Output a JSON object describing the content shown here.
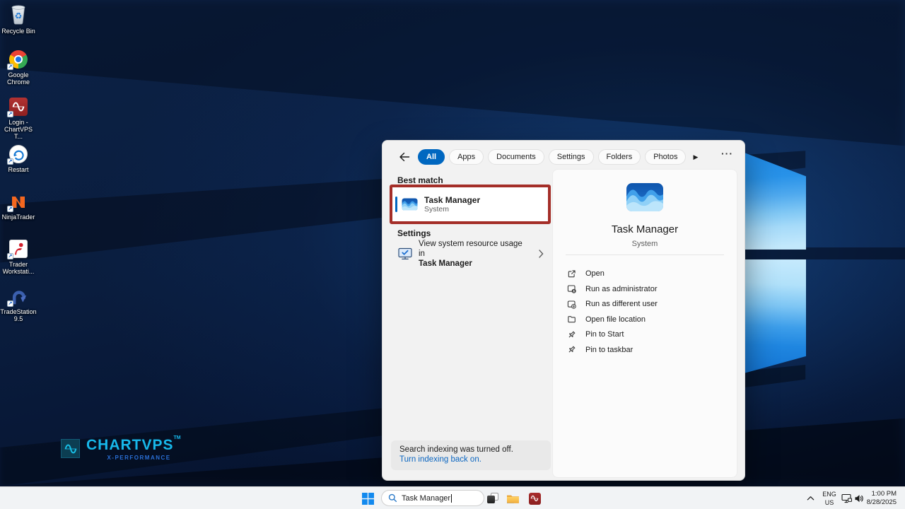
{
  "desktop": {
    "icons": [
      {
        "label": "Recycle Bin"
      },
      {
        "label": "Google Chrome"
      },
      {
        "label": "Login - ChartVPS T..."
      },
      {
        "label": "Restart"
      },
      {
        "label": "NinjaTrader"
      },
      {
        "label": "Trader Workstati..."
      },
      {
        "label": "TradeStation 9.5"
      }
    ],
    "watermark": {
      "brand": "CHARTVPS",
      "tm": "TM",
      "tagline": "X-PERFORMANCE"
    }
  },
  "search": {
    "tabs": [
      {
        "label": "All"
      },
      {
        "label": "Apps"
      },
      {
        "label": "Documents"
      },
      {
        "label": "Settings"
      },
      {
        "label": "Folders"
      },
      {
        "label": "Photos"
      }
    ],
    "best_match_header": "Best match",
    "best_match": {
      "title": "Task Manager",
      "subtitle": "System"
    },
    "settings_header": "Settings",
    "settings_item": {
      "line1": "View system resource usage in",
      "line2": "Task Manager"
    },
    "footer": {
      "message": "Search indexing was turned off.",
      "link": "Turn indexing back on."
    },
    "preview": {
      "title": "Task Manager",
      "subtitle": "System",
      "actions": [
        {
          "label": "Open"
        },
        {
          "label": "Run as administrator"
        },
        {
          "label": "Run as different user"
        },
        {
          "label": "Open file location"
        },
        {
          "label": "Pin to Start"
        },
        {
          "label": "Pin to taskbar"
        }
      ]
    }
  },
  "taskbar": {
    "search_value": "Task Manager",
    "tray": {
      "lang1": "ENG",
      "lang2": "US",
      "time": "1:00 PM",
      "date": "8/28/2025"
    }
  },
  "colors": {
    "accent": "#0067C0",
    "annotation_red": "#A42E28",
    "link_blue": "#0B66C1",
    "brand_cyan": "#17B8EA",
    "tagline_blue": "#2A6FD6",
    "pane_blue": "#1F86E0"
  }
}
